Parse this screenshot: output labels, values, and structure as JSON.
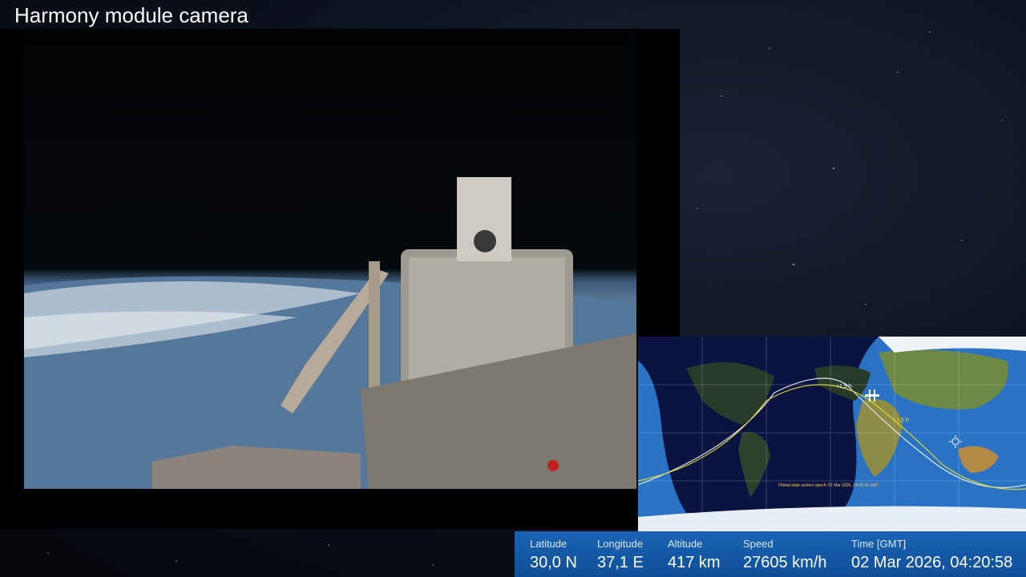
{
  "camera": {
    "title": "Harmony module camera"
  },
  "map": {
    "epoch_note": "Orbital state vectors epoch: 01 Mar 2026, 14:09:39 GMT",
    "markers": [
      "+1,5 h",
      "-1,5 h"
    ],
    "sun_icon": "sun-icon",
    "iss_icon": "iss-icon"
  },
  "telemetry": {
    "latitude": {
      "label": "Latitude",
      "value": "30,0 N"
    },
    "longitude": {
      "label": "Longitude",
      "value": "37,1 E"
    },
    "altitude": {
      "label": "Altitude",
      "value": "417 km"
    },
    "speed": {
      "label": "Speed",
      "value": "27605 km/h"
    },
    "time": {
      "label": "Time [GMT]",
      "value": "02 Mar 2026, 04:20:58"
    }
  }
}
